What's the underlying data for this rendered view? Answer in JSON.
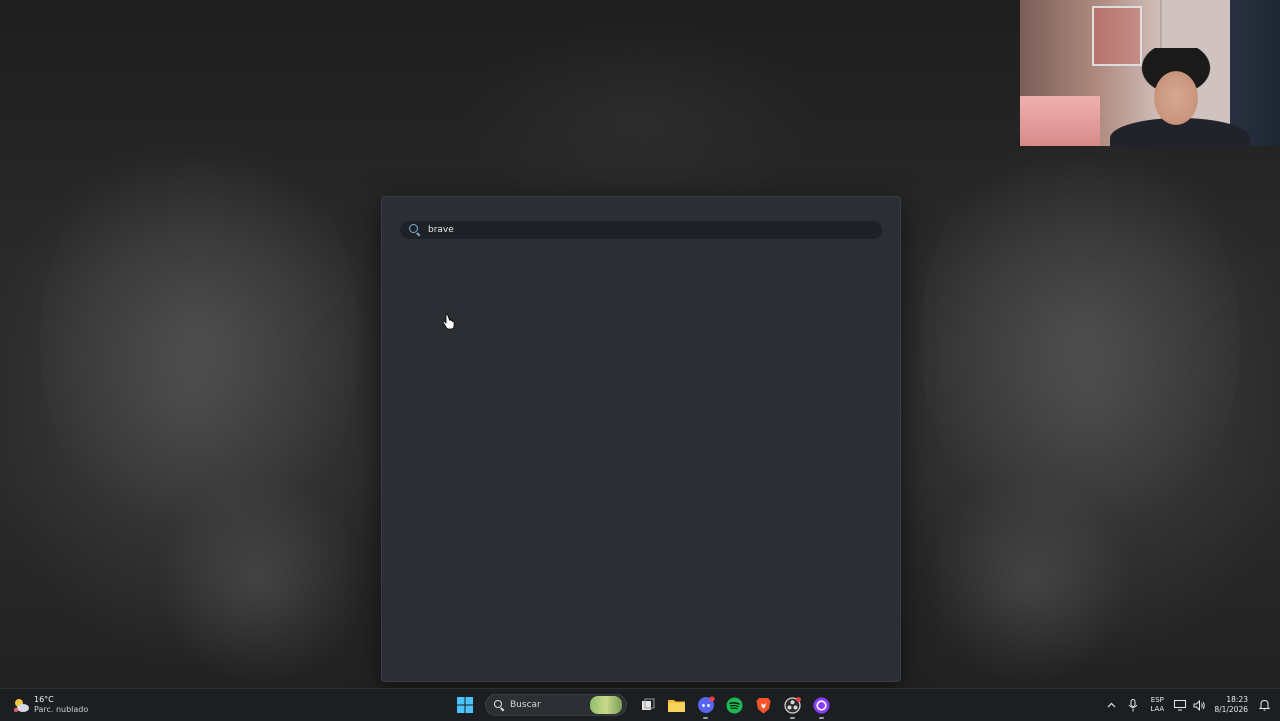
{
  "launcher": {
    "search_value": "brave",
    "search_placeholder": ""
  },
  "taskbar": {
    "weather": {
      "temperature": "16°C",
      "condition": "Parc. nublado"
    },
    "search_label": "Buscar",
    "pinned_apps": [
      {
        "name": "start",
        "icon": "windows-logo-icon"
      },
      {
        "name": "task-view",
        "icon": "task-view-icon"
      },
      {
        "name": "file-explorer",
        "icon": "folder-icon"
      },
      {
        "name": "discord",
        "icon": "discord-icon"
      },
      {
        "name": "spotify",
        "icon": "spotify-icon"
      },
      {
        "name": "brave",
        "icon": "brave-lion-icon"
      },
      {
        "name": "obs",
        "icon": "obs-icon"
      },
      {
        "name": "app",
        "icon": "purple-circle-icon"
      }
    ],
    "language": {
      "lang": "ESP",
      "layout": "LAA"
    },
    "clock": {
      "time": "18:23",
      "date": "8/1/2026"
    }
  },
  "colors": {
    "launcher_bg": "#2b2f34",
    "taskbar_bg": "#1c1f22",
    "spotify_green": "#1db954",
    "brave_orange": "#fb542b",
    "discord_blurple": "#5865f2",
    "windows_blue": "#4cc2ff"
  }
}
